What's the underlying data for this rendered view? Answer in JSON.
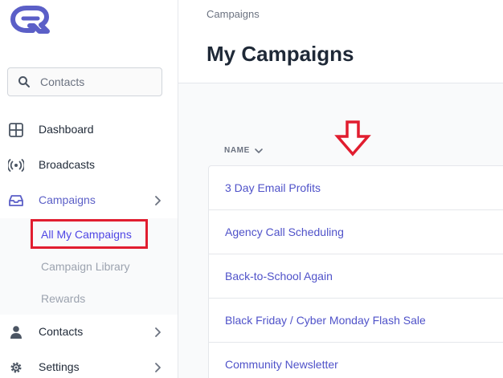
{
  "brand": {
    "accent": "#5b5fc7",
    "highlight": "#e11d2f"
  },
  "search": {
    "label": "Contacts",
    "icon": "search-icon"
  },
  "nav": {
    "dashboard": {
      "label": "Dashboard",
      "icon": "grid-icon"
    },
    "broadcasts": {
      "label": "Broadcasts",
      "icon": "broadcast-icon"
    },
    "campaigns": {
      "label": "Campaigns",
      "icon": "inbox-icon"
    },
    "contacts": {
      "label": "Contacts",
      "icon": "user-icon"
    },
    "settings": {
      "label": "Settings",
      "icon": "gear-icon"
    }
  },
  "subnav": {
    "all_my_campaigns": "All My Campaigns",
    "campaign_library": "Campaign Library",
    "rewards": "Rewards"
  },
  "header": {
    "breadcrumb": "Campaigns",
    "title": "My Campaigns"
  },
  "table": {
    "column_name": "NAME",
    "rows": [
      "3 Day Email Profits",
      "Agency Call Scheduling",
      "Back-to-School Again",
      "Black Friday / Cyber Monday Flash Sale",
      "Community Newsletter"
    ]
  }
}
